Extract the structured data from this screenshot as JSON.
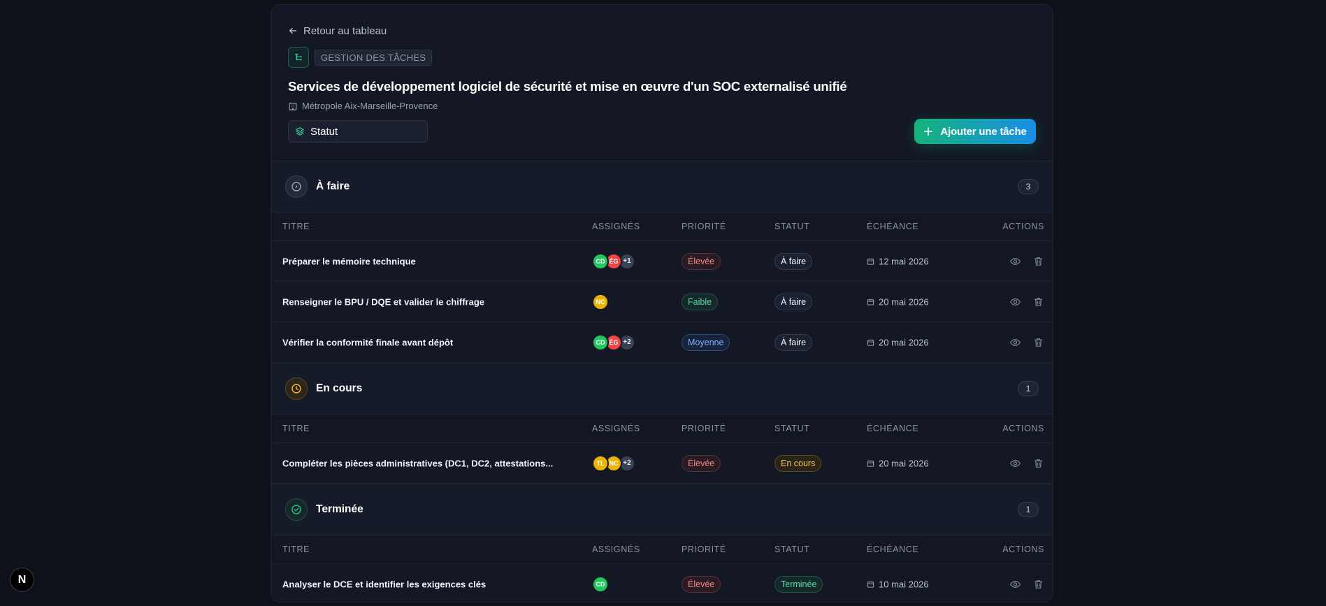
{
  "header": {
    "back_label": "Retour au tableau",
    "tag": "GESTION DES TÂCHES",
    "title": "Services de développement logiciel de sécurité et mise en œuvre d'un SOC externalisé unifié",
    "organization": "Métropole Aix-Marseille-Provence",
    "group_by_label": "Statut",
    "add_button_label": "Ajouter une tâche"
  },
  "columns": {
    "title": "TITRE",
    "assignees": "ASSIGNÉS",
    "priority": "PRIORITÉ",
    "status": "STATUT",
    "due": "ÉCHÉANCE",
    "actions": "ACTIONS"
  },
  "sections": [
    {
      "name": "À faire",
      "count": "3",
      "icon": "circle-play-icon",
      "accent": "#9aa3b2",
      "tasks": [
        {
          "title": "Préparer le mémoire technique",
          "assignees": [
            {
              "initials": "CD",
              "color": "#22c55e"
            },
            {
              "initials": "ÉG",
              "color": "#ef4444"
            }
          ],
          "extra": "+1",
          "priority": "Élevée",
          "priority_kind": "high",
          "status": "À faire",
          "status_kind": "todo",
          "due": "12 mai 2026"
        },
        {
          "title": "Renseigner le BPU / DQE et valider le chiffrage",
          "assignees": [
            {
              "initials": "NC",
              "color": "#eab308"
            }
          ],
          "extra": "",
          "priority": "Faible",
          "priority_kind": "low",
          "status": "À faire",
          "status_kind": "todo",
          "due": "20 mai 2026"
        },
        {
          "title": "Vérifier la conformité finale avant dépôt",
          "assignees": [
            {
              "initials": "CD",
              "color": "#22c55e"
            },
            {
              "initials": "ÉG",
              "color": "#ef4444"
            }
          ],
          "extra": "+2",
          "priority": "Moyenne",
          "priority_kind": "mid",
          "status": "À faire",
          "status_kind": "todo",
          "due": "20 mai 2026"
        }
      ]
    },
    {
      "name": "En cours",
      "count": "1",
      "icon": "clock-icon",
      "accent": "#f5b83d",
      "tasks": [
        {
          "title": "Compléter les pièces administratives (DC1, DC2, attestations...",
          "assignees": [
            {
              "initials": "TL",
              "color": "#eab308"
            },
            {
              "initials": "NC",
              "color": "#eab308"
            }
          ],
          "extra": "+2",
          "priority": "Élevée",
          "priority_kind": "high",
          "status": "En cours",
          "status_kind": "prog",
          "due": "20 mai 2026"
        }
      ]
    },
    {
      "name": "Terminée",
      "count": "1",
      "icon": "check-circle-icon",
      "accent": "#2fbf84",
      "tasks": [
        {
          "title": "Analyser le DCE et identifier les exigences clés",
          "assignees": [
            {
              "initials": "CD",
              "color": "#22c55e"
            }
          ],
          "extra": "",
          "priority": "Élevée",
          "priority_kind": "high",
          "status": "Terminée",
          "status_kind": "done",
          "due": "10 mai 2026"
        }
      ]
    }
  ],
  "corner_badge": "N"
}
